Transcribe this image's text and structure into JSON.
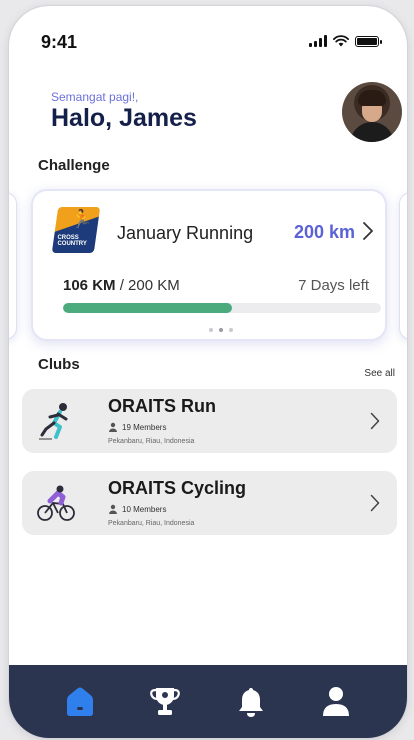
{
  "status": {
    "time": "9:41"
  },
  "greeting": {
    "subtitle": "Semangat pagi!,",
    "name": "Halo, James"
  },
  "challenge_section": {
    "title": "Challenge"
  },
  "challenge": {
    "name": "January Running",
    "target": "200 km",
    "badge_text": "CROSS COUNTRY",
    "progress_done": "106 KM",
    "progress_total": " / 200 KM",
    "progress_fraction": 0.53,
    "days_left": "7 Days left",
    "carousel_pages": 3,
    "carousel_active": 1
  },
  "clubs_section": {
    "title": "Clubs",
    "see_all": "See all"
  },
  "clubs": [
    {
      "name": "ORAITS Run",
      "members": "19 Members",
      "location": "Pekanbaru, Riau, Indonesia",
      "icon": "runner-icon"
    },
    {
      "name": "ORAITS Cycling",
      "members": "10 Members",
      "location": "Pekanbaru, Riau, Indonesia",
      "icon": "cyclist-icon"
    }
  ],
  "nav": {
    "items": [
      "home-icon",
      "trophy-icon",
      "bell-icon",
      "profile-icon"
    ],
    "active": "home-icon",
    "active_color": "#2f80ed",
    "inactive_color": "#ffffff",
    "background": "#2b3550"
  },
  "colors": {
    "accent": "#5b62d6",
    "progress": "#4bab7d",
    "title": "#15204a"
  }
}
